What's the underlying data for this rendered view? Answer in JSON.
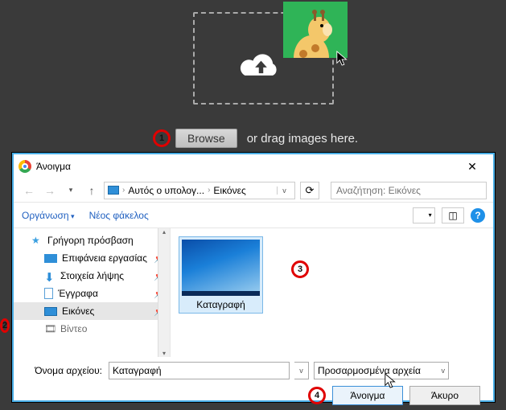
{
  "upload": {
    "browse_label": "Browse",
    "drag_text": "or drag images here."
  },
  "dialog": {
    "title": "Άνοιγμα",
    "nav": {
      "crumb1": "Αυτός ο υπολογ...",
      "crumb2": "Εικόνες",
      "search_placeholder": "Αναζήτηση: Εικόνες"
    },
    "toolbar": {
      "organize": "Οργάνωση",
      "new_folder": "Νέος φάκελος"
    },
    "sidebar": {
      "items": [
        {
          "label": "Γρήγορη πρόσβαση"
        },
        {
          "label": "Επιφάνεια εργασίας"
        },
        {
          "label": "Στοιχεία λήψης"
        },
        {
          "label": "Έγγραφα"
        },
        {
          "label": "Εικόνες"
        },
        {
          "label": "Βίντεο"
        }
      ]
    },
    "file": {
      "name": "Καταγραφή"
    },
    "footer": {
      "filename_label": "Όνομα αρχείου:",
      "filename_value": "Καταγραφή",
      "filetype": "Προσαρμοσμένα αρχεία",
      "open": "Άνοιγμα",
      "cancel": "Άκυρο"
    }
  },
  "markers": {
    "m1": "1",
    "m2": "2",
    "m3": "3",
    "m4": "4"
  }
}
